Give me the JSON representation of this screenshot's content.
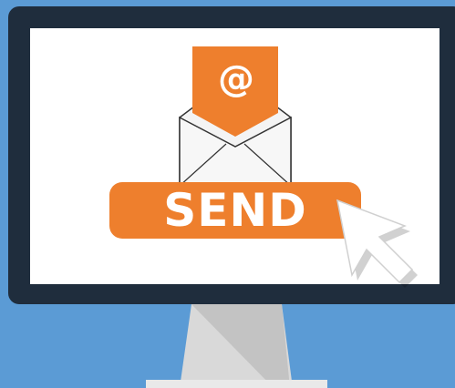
{
  "email_icon": {
    "symbol": "@",
    "icon": "envelope-with-letter-icon"
  },
  "send_button": {
    "label": "SEND"
  },
  "cursor": {
    "icon": "mouse-pointer-icon"
  },
  "colors": {
    "background": "#5b9bd5",
    "monitor_frame": "#1f2d3d",
    "screen": "#ffffff",
    "accent": "#ee7f2d",
    "stand": "#d9d9d9"
  }
}
